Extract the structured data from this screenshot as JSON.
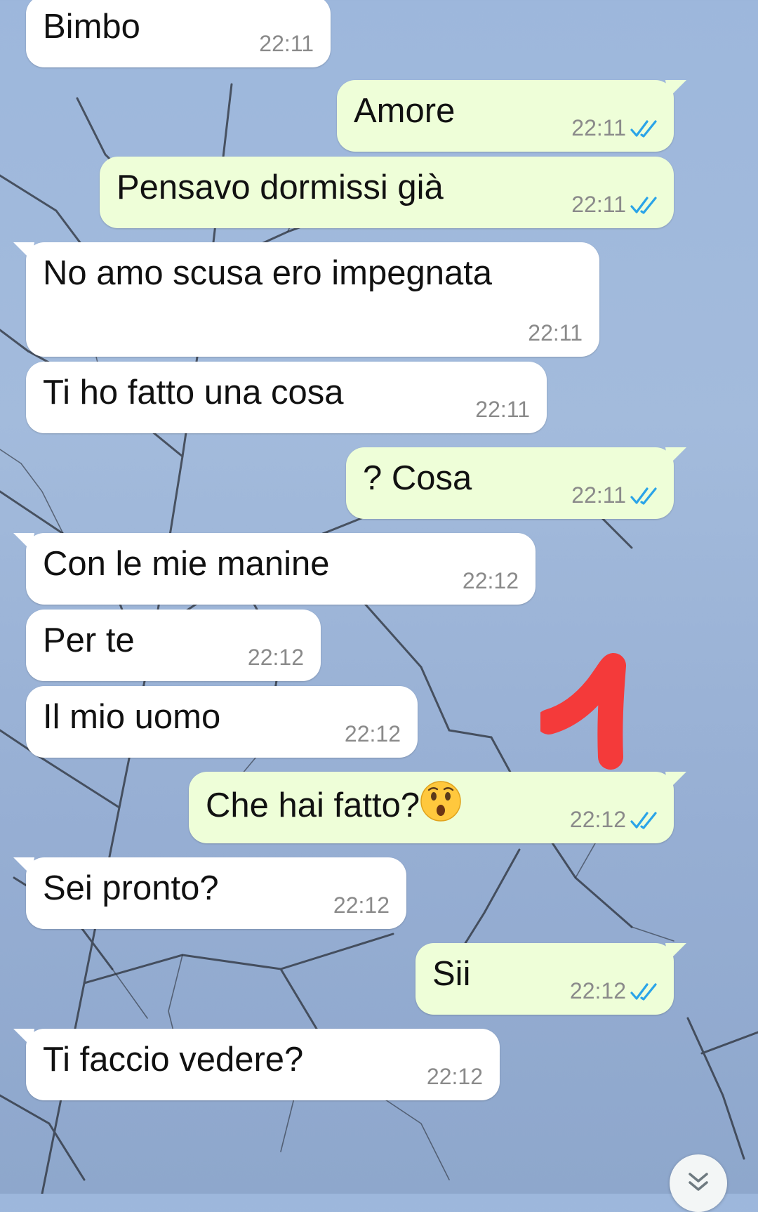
{
  "messages": [
    {
      "dir": "in",
      "text": "Bimbo",
      "time": "22:11"
    },
    {
      "dir": "out",
      "text": "Amore",
      "time": "22:11",
      "status": "read"
    },
    {
      "dir": "out",
      "text": "Pensavo dormissi già",
      "time": "22:11",
      "status": "read"
    },
    {
      "dir": "in",
      "text": "No amo scusa ero impegnata",
      "time": "22:11"
    },
    {
      "dir": "in",
      "text": "Ti ho fatto una cosa",
      "time": "22:11"
    },
    {
      "dir": "out",
      "text": "? Cosa",
      "time": "22:11",
      "status": "read"
    },
    {
      "dir": "in",
      "text": "Con le mie manine",
      "time": "22:12"
    },
    {
      "dir": "in",
      "text": "Per te",
      "time": "22:12"
    },
    {
      "dir": "in",
      "text": "Il mio uomo",
      "time": "22:12"
    },
    {
      "dir": "out",
      "text": "Che hai fatto?",
      "time": "22:12",
      "status": "read",
      "emoji": "hushed-face"
    },
    {
      "dir": "in",
      "text": "Sei pronto?",
      "time": "22:12"
    },
    {
      "dir": "out",
      "text": "Sii",
      "time": "22:12",
      "status": "read"
    },
    {
      "dir": "in",
      "text": "Ti faccio vedere?",
      "time": "22:12"
    }
  ],
  "annotation": {
    "shape": "digit-1",
    "color": "#f43a3a"
  },
  "colors": {
    "incoming_bubble": "#ffffff",
    "outgoing_bubble": "#eefed8",
    "read_ticks": "#2aa4e8",
    "time_text": "#8a8a8a"
  },
  "icons": {
    "read_status": "double-check-icon",
    "scroll_button": "double-chevron-down-icon"
  }
}
